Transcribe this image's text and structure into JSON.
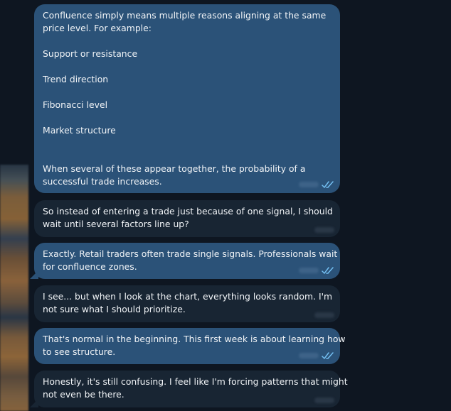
{
  "colors": {
    "background": "#0e1621",
    "outgoing_bubble": "#2b5278",
    "incoming_bubble": "#182533",
    "text": "#f1f4f7",
    "read_checks": "#72bdf0"
  },
  "messages": [
    {
      "direction": "outgoing",
      "read_icon": "double-check-icon",
      "lines": [
        "Confluence simply means multiple reasons aligning at the same",
        "price level. For example:",
        "",
        "Support or resistance",
        "",
        "Trend direction",
        "",
        "Fibonacci level",
        "",
        "Market structure",
        "",
        "",
        "When several of these appear together, the probability of a",
        "successful trade increases."
      ]
    },
    {
      "direction": "incoming",
      "lines": [
        "So instead of entering a trade just because of one signal, I should",
        "wait until several factors line up?"
      ]
    },
    {
      "direction": "outgoing",
      "read_icon": "double-check-icon",
      "lines": [
        "Exactly. Retail traders often trade single signals. Professionals wait",
        "for confluence zones."
      ]
    },
    {
      "direction": "incoming",
      "lines": [
        "I see... but when I look at the chart, everything looks random. I'm",
        "not sure what I should prioritize."
      ]
    },
    {
      "direction": "outgoing",
      "read_icon": "double-check-icon",
      "lines": [
        "That's normal in the beginning. This first week is about learning how",
        "to see structure."
      ]
    },
    {
      "direction": "incoming",
      "lines": [
        "Honestly, it's still confusing. I feel like I'm forcing patterns that might",
        "not even be there."
      ]
    }
  ]
}
